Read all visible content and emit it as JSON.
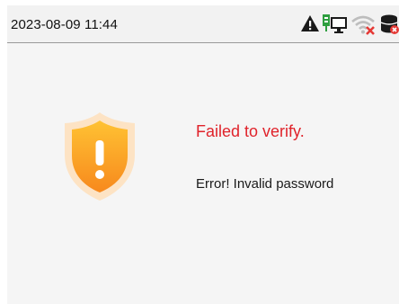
{
  "status_bar": {
    "datetime": "2023-08-09 11:44",
    "icons": [
      "warning-icon",
      "ethernet-connected-icon",
      "wifi-disconnected-icon",
      "database-error-icon"
    ]
  },
  "dialog": {
    "icon": "shield-exclamation-icon",
    "title": "Failed to verify.",
    "message": "Error! Invalid password"
  },
  "colors": {
    "title_red": "#e0232b",
    "shield_orange": "#f7941d",
    "shield_yellow": "#ffc233",
    "ethernet_green": "#2e9e3f",
    "wifi_error_red": "#e53935"
  }
}
